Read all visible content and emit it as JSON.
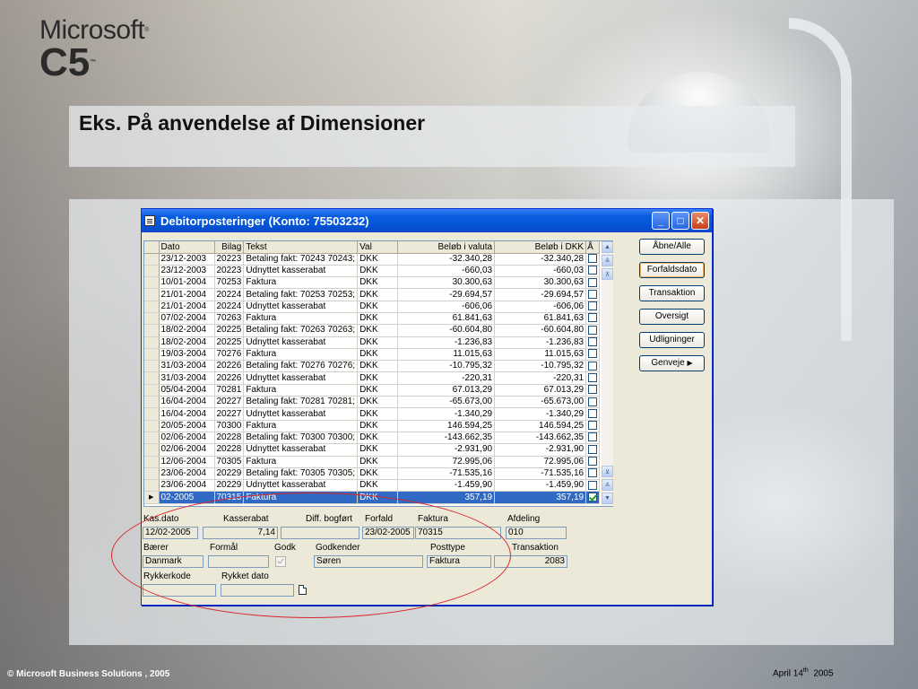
{
  "logo": {
    "brand": "Microsoft",
    "product": "C5",
    "tm1": "®",
    "tm2": "™"
  },
  "slide": {
    "title": "Eks. På anvendelse af Dimensioner"
  },
  "window": {
    "title": "Debitorposteringer (Konto: 75503232)",
    "columns": {
      "dato": "Dato",
      "bilag": "Bilag",
      "tekst": "Tekst",
      "val": "Val",
      "valuta": "Beløb i valuta",
      "dkk": "Beløb i DKK",
      "a": "Å"
    },
    "rows": [
      {
        "dato": "23/12-2003",
        "bilag": "20223",
        "tekst": "Betaling fakt: 70243 70243;",
        "val": "DKK",
        "valuta": "-32.340,28",
        "dkk": "-32.340,28"
      },
      {
        "dato": "23/12-2003",
        "bilag": "20223",
        "tekst": "Udnyttet kasserabat",
        "val": "DKK",
        "valuta": "-660,03",
        "dkk": "-660,03"
      },
      {
        "dato": "10/01-2004",
        "bilag": "70253",
        "tekst": "Faktura",
        "val": "DKK",
        "valuta": "30.300,63",
        "dkk": "30.300,63"
      },
      {
        "dato": "21/01-2004",
        "bilag": "20224",
        "tekst": "Betaling fakt: 70253 70253;",
        "val": "DKK",
        "valuta": "-29.694,57",
        "dkk": "-29.694,57"
      },
      {
        "dato": "21/01-2004",
        "bilag": "20224",
        "tekst": "Udnyttet kasserabat",
        "val": "DKK",
        "valuta": "-606,06",
        "dkk": "-606,06"
      },
      {
        "dato": "07/02-2004",
        "bilag": "70263",
        "tekst": "Faktura",
        "val": "DKK",
        "valuta": "61.841,63",
        "dkk": "61.841,63"
      },
      {
        "dato": "18/02-2004",
        "bilag": "20225",
        "tekst": "Betaling fakt: 70263 70263;",
        "val": "DKK",
        "valuta": "-60.604,80",
        "dkk": "-60.604,80"
      },
      {
        "dato": "18/02-2004",
        "bilag": "20225",
        "tekst": "Udnyttet kasserabat",
        "val": "DKK",
        "valuta": "-1.236,83",
        "dkk": "-1.236,83"
      },
      {
        "dato": "19/03-2004",
        "bilag": "70276",
        "tekst": "Faktura",
        "val": "DKK",
        "valuta": "11.015,63",
        "dkk": "11.015,63"
      },
      {
        "dato": "31/03-2004",
        "bilag": "20226",
        "tekst": "Betaling fakt: 70276 70276;",
        "val": "DKK",
        "valuta": "-10.795,32",
        "dkk": "-10.795,32"
      },
      {
        "dato": "31/03-2004",
        "bilag": "20226",
        "tekst": "Udnyttet kasserabat",
        "val": "DKK",
        "valuta": "-220,31",
        "dkk": "-220,31"
      },
      {
        "dato": "05/04-2004",
        "bilag": "70281",
        "tekst": "Faktura",
        "val": "DKK",
        "valuta": "67.013,29",
        "dkk": "67.013,29"
      },
      {
        "dato": "16/04-2004",
        "bilag": "20227",
        "tekst": "Betaling fakt: 70281 70281;",
        "val": "DKK",
        "valuta": "-65.673,00",
        "dkk": "-65.673,00"
      },
      {
        "dato": "16/04-2004",
        "bilag": "20227",
        "tekst": "Udnyttet kasserabat",
        "val": "DKK",
        "valuta": "-1.340,29",
        "dkk": "-1.340,29"
      },
      {
        "dato": "20/05-2004",
        "bilag": "70300",
        "tekst": "Faktura",
        "val": "DKK",
        "valuta": "146.594,25",
        "dkk": "146.594,25"
      },
      {
        "dato": "02/06-2004",
        "bilag": "20228",
        "tekst": "Betaling fakt: 70300 70300;",
        "val": "DKK",
        "valuta": "-143.662,35",
        "dkk": "-143.662,35"
      },
      {
        "dato": "02/06-2004",
        "bilag": "20228",
        "tekst": "Udnyttet kasserabat",
        "val": "DKK",
        "valuta": "-2.931,90",
        "dkk": "-2.931,90"
      },
      {
        "dato": "12/06-2004",
        "bilag": "70305",
        "tekst": "Faktura",
        "val": "DKK",
        "valuta": "72.995,06",
        "dkk": "72.995,06"
      },
      {
        "dato": "23/06-2004",
        "bilag": "20229",
        "tekst": "Betaling fakt: 70305 70305;",
        "val": "DKK",
        "valuta": "-71.535,16",
        "dkk": "-71.535,16"
      },
      {
        "dato": "23/06-2004",
        "bilag": "20229",
        "tekst": "Udnyttet kasserabat",
        "val": "DKK",
        "valuta": "-1.459,90",
        "dkk": "-1.459,90"
      },
      {
        "dato": "02-2005",
        "bilag": "70315",
        "tekst": "Faktura",
        "val": "DKK",
        "valuta": "357,19",
        "dkk": "357,19",
        "selected": true
      }
    ],
    "buttons": {
      "aabne": "Åbne/Alle",
      "forfaldsdato": "Forfaldsdato",
      "transaktion": "Transaktion",
      "oversigt": "Oversigt",
      "udligninger": "Udligninger",
      "genveje": "Genveje",
      "genveje_arrow": "▶"
    },
    "details": {
      "labels": {
        "kasdato": "Kas.dato",
        "kasserabat": "Kasserabat",
        "diff": "Diff. bogført",
        "forfald": "Forfald",
        "faktura": "Faktura",
        "afdeling": "Afdeling",
        "baerer": "Bærer",
        "formaal": "Formål",
        "godk": "Godk",
        "godkender": "Godkender",
        "posttype": "Posttype",
        "transaktion": "Transaktion",
        "rykkerkode": "Rykkerkode",
        "rykketdato": "Rykket dato"
      },
      "values": {
        "kasdato": "12/02-2005",
        "kasserabat": "7,14",
        "diff": "",
        "forfald": "23/02-2005",
        "faktura": "70315",
        "afdeling": "010",
        "baerer": "Danmark",
        "formaal": "",
        "godkender": "Søren",
        "posttype": "Faktura",
        "transaktion": "2083",
        "rykkerkode": "",
        "rykketdato": ""
      }
    }
  },
  "footer": {
    "left": "© Microsoft Business Solutions , 2005",
    "right_prefix": "April 14",
    "right_sup": "th",
    "right_year": "2005"
  }
}
